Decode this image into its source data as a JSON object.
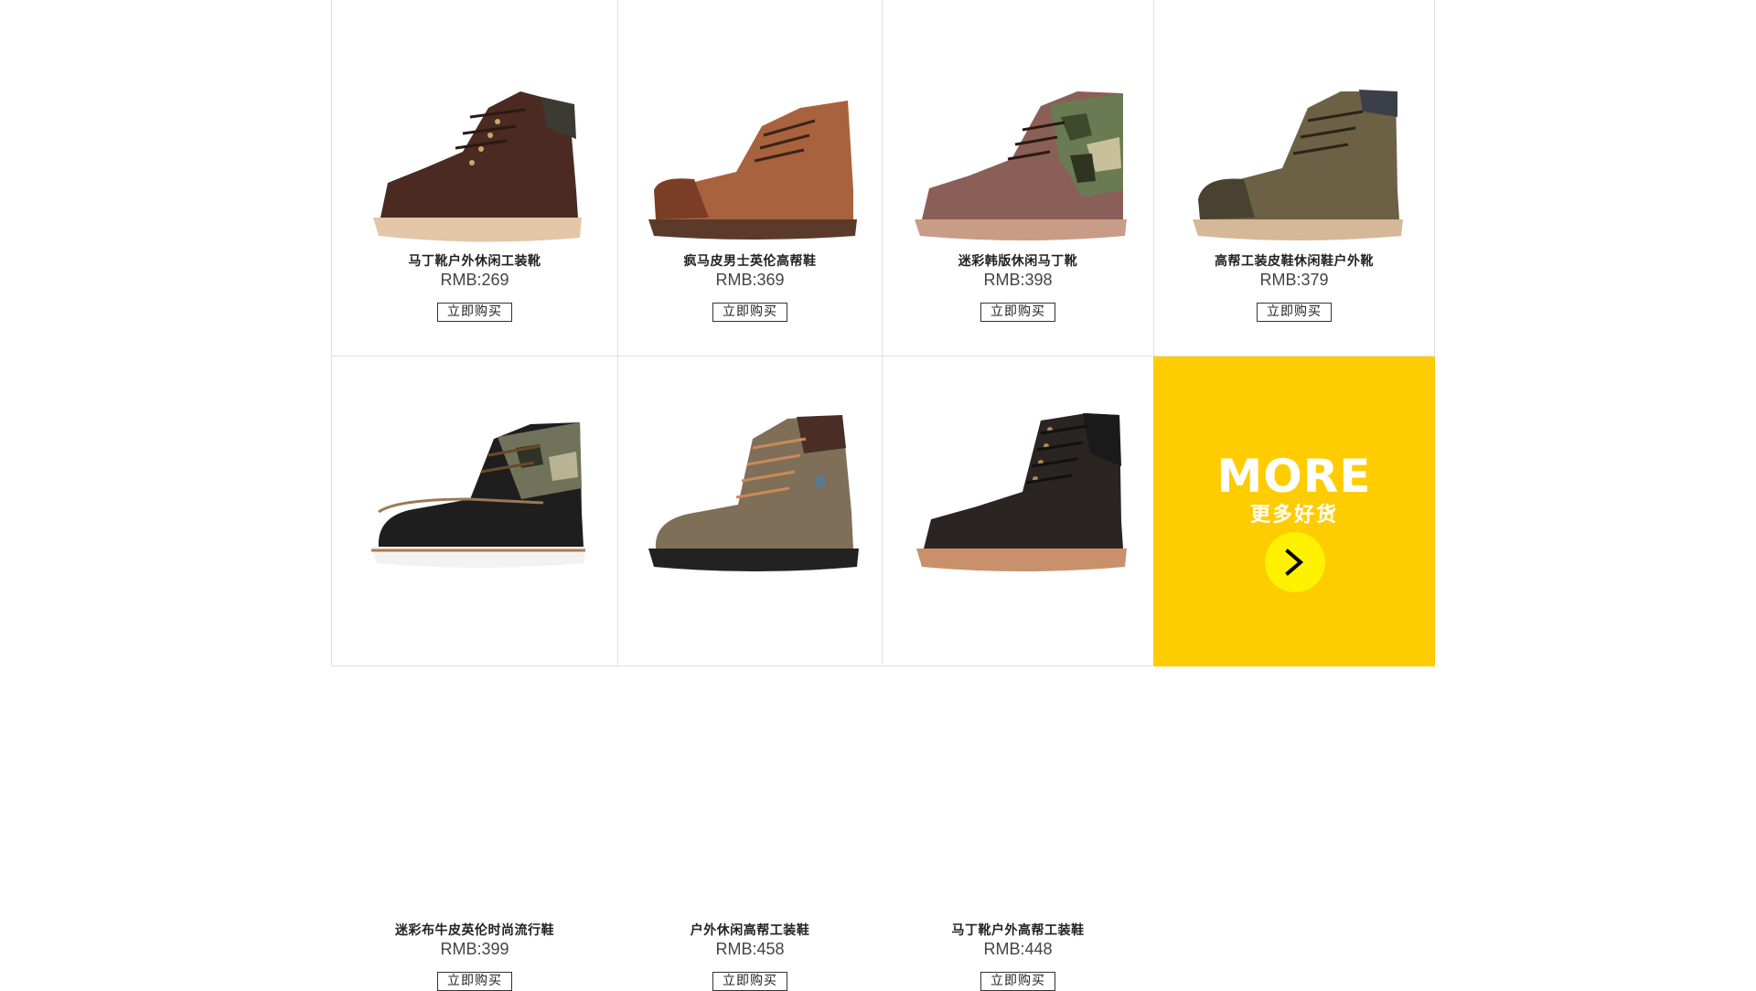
{
  "products": [
    {
      "name": "马丁靴户外休闲工装靴",
      "price": "RMB:269",
      "buy_label": "立即购买",
      "icon": "brown-suede-boot-icon",
      "colors": {
        "upper": "#4b2a22",
        "collar": "#3b3b33",
        "sole": "#e3c7a8"
      }
    },
    {
      "name": "疯马皮男士英伦高帮鞋",
      "price": "RMB:369",
      "buy_label": "立即购买",
      "icon": "tan-leather-chukka-icon",
      "colors": {
        "upper": "#a9623e",
        "collar": "#8a4b2e",
        "sole": "#5c3a2a"
      }
    },
    {
      "name": "迷彩韩版休闲马丁靴",
      "price": "RMB:398",
      "buy_label": "立即购买",
      "icon": "camo-suede-boot-icon",
      "colors": {
        "upper": "#8a5f58",
        "collar": "#6a7a52",
        "sole": "#c99c87"
      }
    },
    {
      "name": "高帮工装皮鞋休闲鞋户外靴",
      "price": "RMB:379",
      "buy_label": "立即购买",
      "icon": "olive-work-boot-icon",
      "colors": {
        "upper": "#6d6145",
        "collar": "#3a3f4a",
        "sole": "#d4b898"
      }
    },
    {
      "name": "迷彩布牛皮英伦时尚流行鞋",
      "price": "RMB:399",
      "buy_label": "立即购买",
      "icon": "black-camo-boat-shoe-icon",
      "colors": {
        "upper": "#1e1e1e",
        "collar": "#70735a",
        "sole": "#f2f2f2"
      }
    },
    {
      "name": "户外休闲高帮工装鞋",
      "price": "RMB:458",
      "buy_label": "立即购买",
      "icon": "khaki-hiking-boot-icon",
      "colors": {
        "upper": "#7f6f58",
        "collar": "#4a2e26",
        "sole": "#222222"
      }
    },
    {
      "name": "马丁靴户外高帮工装鞋",
      "price": "RMB:448",
      "buy_label": "立即购买",
      "icon": "black-suede-boot-icon",
      "colors": {
        "upper": "#2a2522",
        "collar": "#1a1a1a",
        "sole": "#c8916c"
      }
    }
  ],
  "more": {
    "title": "MORE",
    "subtitle": "更多好货",
    "icon": "chevron-right-icon",
    "bg_color": "#ffcc00",
    "button_color": "#fff100"
  }
}
